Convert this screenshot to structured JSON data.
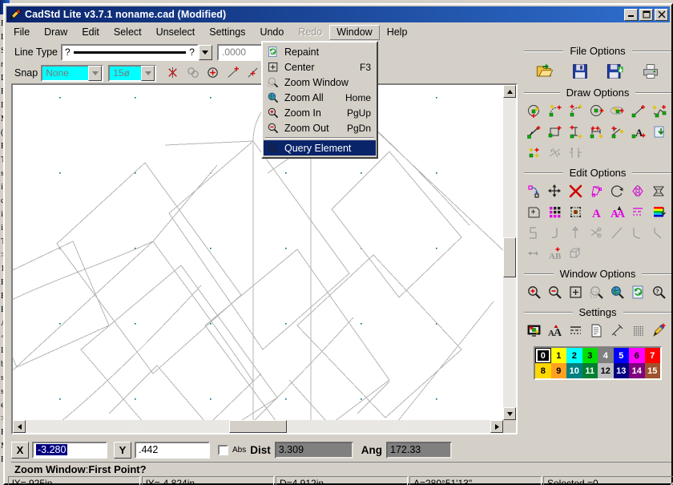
{
  "window": {
    "title": "CadStd Lite v3.7.1  noname.cad  (Modified)",
    "icon": "pencil-icon",
    "minimize_label": "_",
    "maximize_label": "❑",
    "close_label": "✕"
  },
  "menubar": {
    "items": [
      {
        "label": "File",
        "state": "normal"
      },
      {
        "label": "Draw",
        "state": "normal"
      },
      {
        "label": "Edit",
        "state": "normal"
      },
      {
        "label": "Select",
        "state": "normal"
      },
      {
        "label": "Unselect",
        "state": "normal"
      },
      {
        "label": "Settings",
        "state": "normal"
      },
      {
        "label": "Undo",
        "state": "normal"
      },
      {
        "label": "Redo",
        "state": "disabled"
      },
      {
        "label": "Window",
        "state": "open"
      },
      {
        "label": "Help",
        "state": "normal"
      }
    ]
  },
  "window_menu": {
    "items": [
      {
        "label": "Repaint",
        "accel": "",
        "icon": "repaint-icon",
        "highlighted": false
      },
      {
        "label": "Center",
        "accel": "F3",
        "icon": "center-icon",
        "highlighted": false
      },
      {
        "label": "Zoom Window",
        "accel": "",
        "icon": "zoom-window-icon",
        "highlighted": false
      },
      {
        "label": "Zoom All",
        "accel": "Home",
        "icon": "zoom-all-icon",
        "highlighted": false
      },
      {
        "label": "Zoom In",
        "accel": "PgUp",
        "icon": "zoom-in-icon",
        "highlighted": false
      },
      {
        "label": "Zoom Out",
        "accel": "PgDn",
        "icon": "zoom-out-icon",
        "highlighted": false
      },
      {
        "label": "Query Element",
        "accel": "",
        "icon": "query-element-icon",
        "highlighted": true
      }
    ]
  },
  "toolbar": {
    "line_type_label": "Line Type",
    "line_type_value": "?",
    "line_type_value_end": "?",
    "line_width_value": ".0000",
    "color_index": "0",
    "snap_label": "Snap",
    "snap_mode": "None",
    "snap_angle": "15ø",
    "snap_icons": [
      "snap-intersection-icon",
      "snap-nearest-icon",
      "snap-center-icon",
      "snap-endpoint-icon",
      "snap-midpoint-icon",
      "snap-quadrant-icon",
      "snap-perpendicular-icon"
    ]
  },
  "panel": {
    "file_options": {
      "title": "File Options",
      "icons": [
        "open-file-icon",
        "save-file-icon",
        "save-as-icon",
        "print-icon"
      ]
    },
    "draw_options": {
      "title": "Draw Options",
      "icons": [
        "circle-center-radius-icon",
        "arc-3point-icon",
        "arc-start-end-icon",
        "circle-2point-icon",
        "ellipse-icon",
        "line-icon",
        "polyline-icon",
        "freehand-icon",
        "rectangle-icon",
        "dimension-vertical-icon",
        "dimension-horizontal-icon",
        "dimension-angular-icon",
        "text-icon",
        "insert-drawing-icon",
        "point-icon",
        "trim-icon",
        "extend-icon"
      ]
    },
    "edit_options": {
      "title": "Edit Options",
      "icons": [
        "move-node-icon",
        "move-icon",
        "delete-icon",
        "copy-icon",
        "rotate-icon",
        "mirror-icon",
        "scale-icon",
        "offset-icon",
        "array-icon",
        "group-icon",
        "change-font-icon",
        "edit-text-icon",
        "change-linetype-icon",
        "change-color-icon",
        "stretch-icon",
        "join-icon",
        "align-icon",
        "break-icon",
        "line-edit-icon",
        "fillet-icon",
        "chamfer-icon",
        "reverse-icon",
        "text-attribute-icon",
        "extrude-icon"
      ]
    },
    "window_options": {
      "title": "Window Options",
      "icons": [
        "zoom-in-icon",
        "zoom-out-icon",
        "center-icon",
        "zoom-window-icon",
        "zoom-all-icon",
        "repaint-icon",
        "query-element-icon"
      ]
    },
    "settings": {
      "title": "Settings",
      "icons": [
        "display-settings-icon",
        "font-settings-icon",
        "linetype-settings-icon",
        "page-settings-icon",
        "dimension-settings-icon",
        "grid-settings-icon",
        "pen-settings-icon"
      ]
    },
    "palette": {
      "selected_index": 0,
      "swatches": [
        {
          "index": "0",
          "color": "#000000",
          "text": "#ffffff"
        },
        {
          "index": "1",
          "color": "#ffff00",
          "text": "#000000"
        },
        {
          "index": "2",
          "color": "#00ffff",
          "text": "#000000"
        },
        {
          "index": "3",
          "color": "#00e000",
          "text": "#000000"
        },
        {
          "index": "4",
          "color": "#808080",
          "text": "#ffffff"
        },
        {
          "index": "5",
          "color": "#0000ff",
          "text": "#ffffff"
        },
        {
          "index": "6",
          "color": "#ff00ff",
          "text": "#000000"
        },
        {
          "index": "7",
          "color": "#ff0000",
          "text": "#ffffff"
        },
        {
          "index": "8",
          "color": "#ffd700",
          "text": "#000000"
        },
        {
          "index": "9",
          "color": "#ffa020",
          "text": "#000000"
        },
        {
          "index": "10",
          "color": "#008080",
          "text": "#ffffff"
        },
        {
          "index": "11",
          "color": "#008030",
          "text": "#ffffff"
        },
        {
          "index": "12",
          "color": "#c0c0c0",
          "text": "#000000"
        },
        {
          "index": "13",
          "color": "#000080",
          "text": "#ffffff"
        },
        {
          "index": "14",
          "color": "#800080",
          "text": "#ffffff"
        },
        {
          "index": "15",
          "color": "#a0522d",
          "text": "#ffffff"
        }
      ]
    }
  },
  "coordbar": {
    "x_button": "X",
    "x_value": "-3.280",
    "y_button": "Y",
    "y_value": ".442",
    "abs_label": "Abs",
    "dist_label": "Dist",
    "dist_value": "3.309",
    "ang_label": "Ang",
    "ang_value": "172.33"
  },
  "prompt": {
    "command": "Zoom Window",
    "separator": " : ",
    "question": "First Point?"
  },
  "statusbar": {
    "panels": [
      "lX=.925in",
      "lY=-4.824in",
      "D=4.912in",
      "A=280°51'13\"",
      "Selected =0"
    ]
  },
  "canvas": {
    "background": "#ffffff",
    "geometry_color": "#b4b4b4",
    "grid_dot_color": "#006080",
    "description": "CAD drawing of rotated overlapping polygon shapes forming a symmetric fan-like pattern with arcs"
  },
  "background_window": {
    "rows": [
      "F",
      "L",
      "S",
      "n",
      "D",
      "F",
      "I",
      "M",
      "(",
      "F",
      "T",
      "s",
      "ii",
      "c",
      "ii",
      "ii",
      "T",
      ">",
      "1",
      "F",
      "E",
      "E",
      "A",
      "<",
      "I",
      "b",
      "s",
      "s",
      "e",
      ">",
      "F",
      "M",
      "F"
    ]
  }
}
